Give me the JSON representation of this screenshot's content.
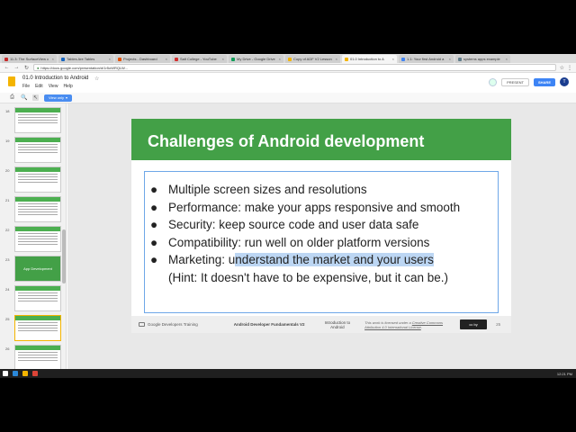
{
  "browser": {
    "tabs": [
      {
        "label": "11.3: The SurfaceView c",
        "color": "#c62828"
      },
      {
        "label": "Tables Are Tables",
        "color": "#1565c0"
      },
      {
        "label": "Projects - Dashboard",
        "color": "#e65100"
      },
      {
        "label": "Salt College - YouTube",
        "color": "#d32f2f"
      },
      {
        "label": "My Drive - Google Drive",
        "color": "#0f9d58"
      },
      {
        "label": "Copy of ADF V2 Lesson",
        "color": "#f4b400"
      },
      {
        "label": "01.0 Introduction to A",
        "color": "#f4b400",
        "active": true
      },
      {
        "label": "1.1: Your first Android a",
        "color": "#4285f4"
      },
      {
        "label": "systems apps example",
        "color": "#607d8b"
      }
    ],
    "url": "https://docs.google.com/presentation/d/1r5oWRQLW...",
    "back": "←",
    "forward": "→",
    "reload": "↻"
  },
  "app": {
    "title": "01.0 Introduction to Android",
    "star": "☆",
    "menu": [
      "File",
      "Edit",
      "View",
      "Help"
    ],
    "present": "PRESENT",
    "share": "SHARE",
    "avatar": "T",
    "view_only": "View only"
  },
  "toolbar": {
    "print": "⎙",
    "zoom": "🔍",
    "select": "↖",
    "view_only_arrow": "▾"
  },
  "filmstrip": {
    "rows": [
      {
        "num": "18",
        "type": "list"
      },
      {
        "num": "19",
        "type": "list"
      },
      {
        "num": "20",
        "type": "list"
      },
      {
        "num": "21",
        "type": "table"
      },
      {
        "num": "22",
        "type": "table"
      },
      {
        "num": "23",
        "type": "full",
        "text": "App Development"
      },
      {
        "num": "24",
        "type": "list"
      },
      {
        "num": "25",
        "type": "list",
        "current": true
      },
      {
        "num": "26",
        "type": "list"
      }
    ]
  },
  "slide": {
    "title": "Challenges of Android development",
    "bullets": [
      {
        "dot": "●",
        "text": "Multiple screen sizes and resolutions"
      },
      {
        "dot": "●",
        "text": "Performance: make your apps responsive and smooth"
      },
      {
        "dot": "●",
        "text": "Security: keep source code and user data safe"
      },
      {
        "dot": "●",
        "text": "Compatibility: run well on older platform versions"
      }
    ],
    "last_bullet": {
      "dot": "●",
      "prefix": "Marketing: u",
      "highlighted": "nderstand the market and your users"
    },
    "hint": "(Hint: It doesn't have to be expensive, but it can be.)",
    "footer": {
      "brand": "Google Developers Training",
      "course": "Android Developer Fundamentals V2",
      "section_line1": "Introduction to",
      "section_line2": "Android",
      "license_prefix": "This work is licensed under a ",
      "license_link": "Creative Commons Attribution 4.0 International License",
      "license_suffix": ".",
      "cc": "cc by",
      "page": "25"
    }
  },
  "taskbar": {
    "time": "12:21 PM"
  }
}
